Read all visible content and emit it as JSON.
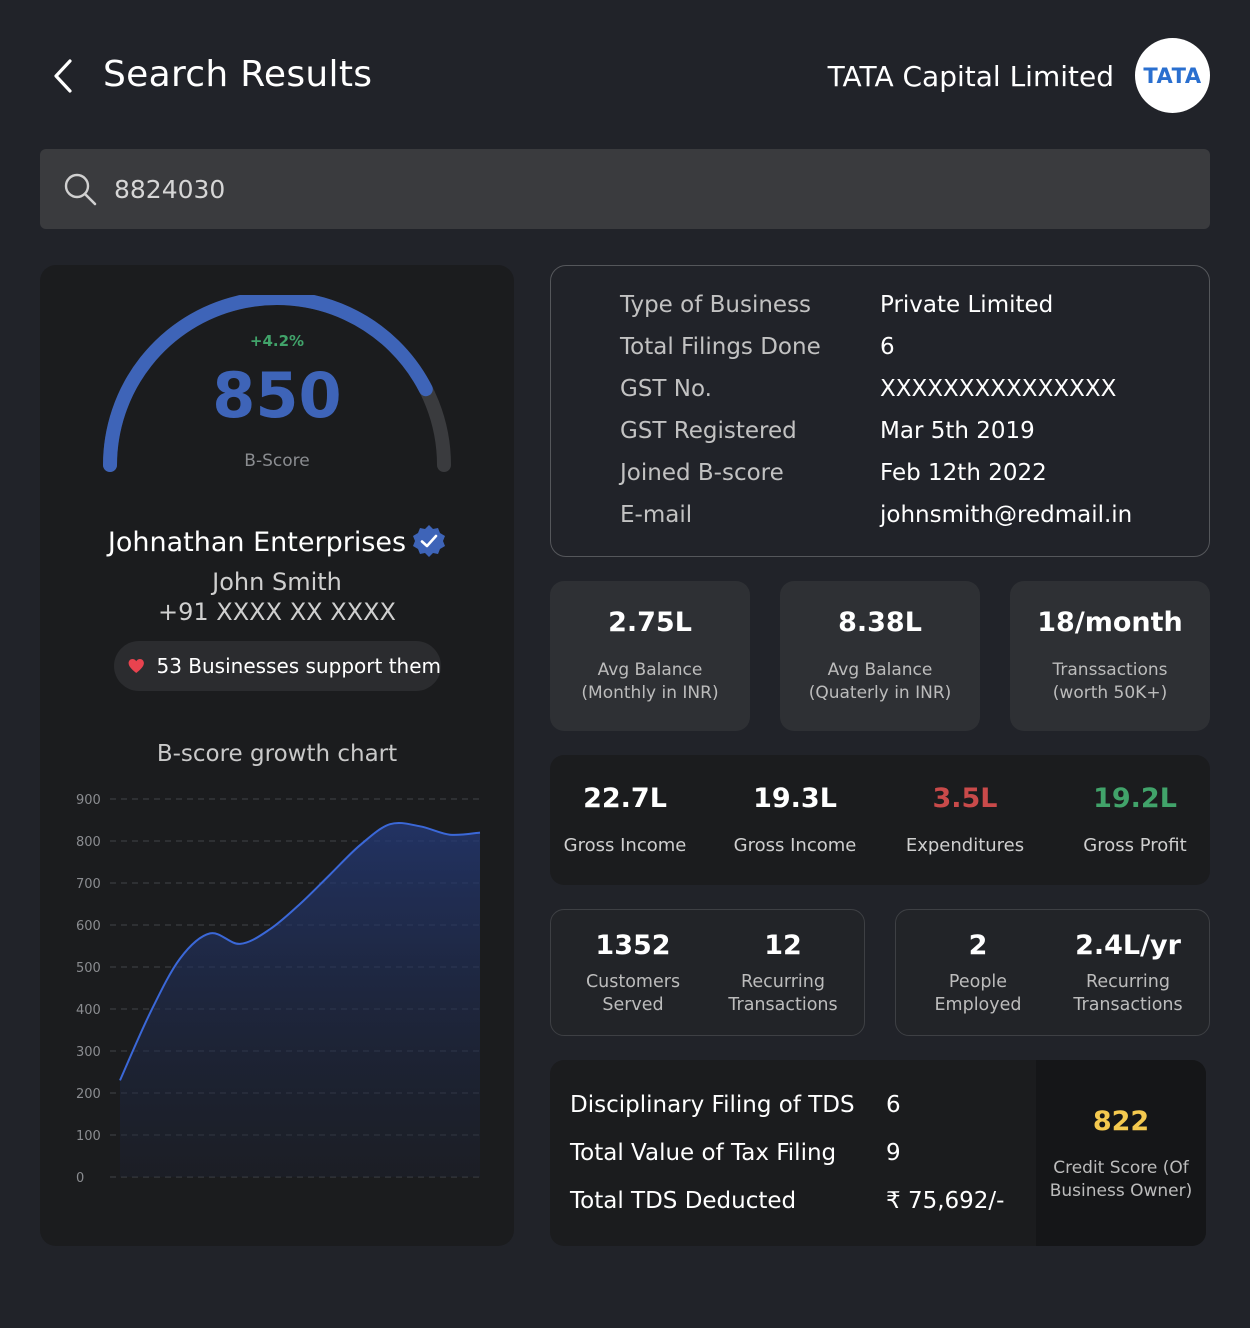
{
  "header": {
    "title": "Search Results",
    "company": "TATA Capital Limited",
    "logo_text": "TATA",
    "back_icon": "chevron-left-icon"
  },
  "search": {
    "value": "8824030",
    "icon": "search-icon"
  },
  "profile": {
    "score_delta": "+4.2%",
    "score": "850",
    "score_label": "B-Score",
    "score_fraction": 0.85,
    "business_name": "Johnathan Enterprises",
    "owner_name": "John Smith",
    "phone": "+91 XXXX XX XXXX",
    "support_text": "53 Businesses support them",
    "colors": {
      "gauge": "#3e64b8",
      "gauge_track": "#3a3b3e",
      "positive": "#41a36a"
    }
  },
  "chart_data": {
    "type": "area",
    "title": "B-score growth chart",
    "yticks": [
      "900",
      "800",
      "700",
      "600",
      "500",
      "400",
      "300",
      "200",
      "100",
      "0"
    ],
    "ylim": [
      0,
      900
    ],
    "x": [
      0,
      1,
      2,
      3,
      4,
      5,
      6,
      7,
      8,
      9,
      10,
      11,
      12
    ],
    "values": [
      230,
      390,
      520,
      580,
      555,
      590,
      650,
      720,
      790,
      840,
      835,
      815,
      820
    ],
    "grid": true,
    "color": "#3b68d8"
  },
  "details": {
    "rows": [
      {
        "key": "Type of Business",
        "value": "Private Limited"
      },
      {
        "key": "Total Filings Done",
        "value": "6"
      },
      {
        "key": "GST No.",
        "value": "XXXXXXXXXXXXXXX"
      },
      {
        "key": "GST Registered",
        "value": "Mar 5th 2019"
      },
      {
        "key": "Joined B-score",
        "value": "Feb 12th 2022"
      },
      {
        "key": "E-mail",
        "value": "johnsmith@redmail.in"
      }
    ]
  },
  "stats": [
    {
      "value": "2.75L",
      "label_1": "Avg Balance",
      "label_2": "(Monthly in INR)"
    },
    {
      "value": "8.38L",
      "label_1": "Avg Balance",
      "label_2": "(Quaterly in INR)"
    },
    {
      "value": "18/month",
      "label_1": "Transsactions",
      "label_2": "(worth 50K+)"
    }
  ],
  "money": [
    {
      "value": "22.7L",
      "label": "Gross Income",
      "color": "#ffffff"
    },
    {
      "value": "19.3L",
      "label": "Gross Income",
      "color": "#ffffff"
    },
    {
      "value": "3.5L",
      "label": "Expenditures",
      "color": "#c94a4a"
    },
    {
      "value": "19.2L",
      "label": "Gross Profit",
      "color": "#41a36a"
    }
  ],
  "pairs": [
    {
      "value": "1352",
      "label_1": "Customers",
      "label_2": "Served"
    },
    {
      "value": "12",
      "label_1": "Recurring",
      "label_2": "Transactions"
    },
    {
      "value": "2",
      "label_1": "People",
      "label_2": "Employed"
    },
    {
      "value": "2.4L/yr",
      "label_1": "Recurring",
      "label_2": "Transactions"
    }
  ],
  "tax": {
    "rows": [
      {
        "key": "Disciplinary Filing of TDS",
        "value": "6"
      },
      {
        "key": "Total Value of Tax Filing",
        "value": "9"
      },
      {
        "key": "Total TDS Deducted",
        "value": "₹ 75,692/-"
      }
    ],
    "credit_score": "822",
    "credit_label_1": "Credit Score (Of",
    "credit_label_2": "Business Owner)",
    "credit_color": "#f4c94f"
  }
}
